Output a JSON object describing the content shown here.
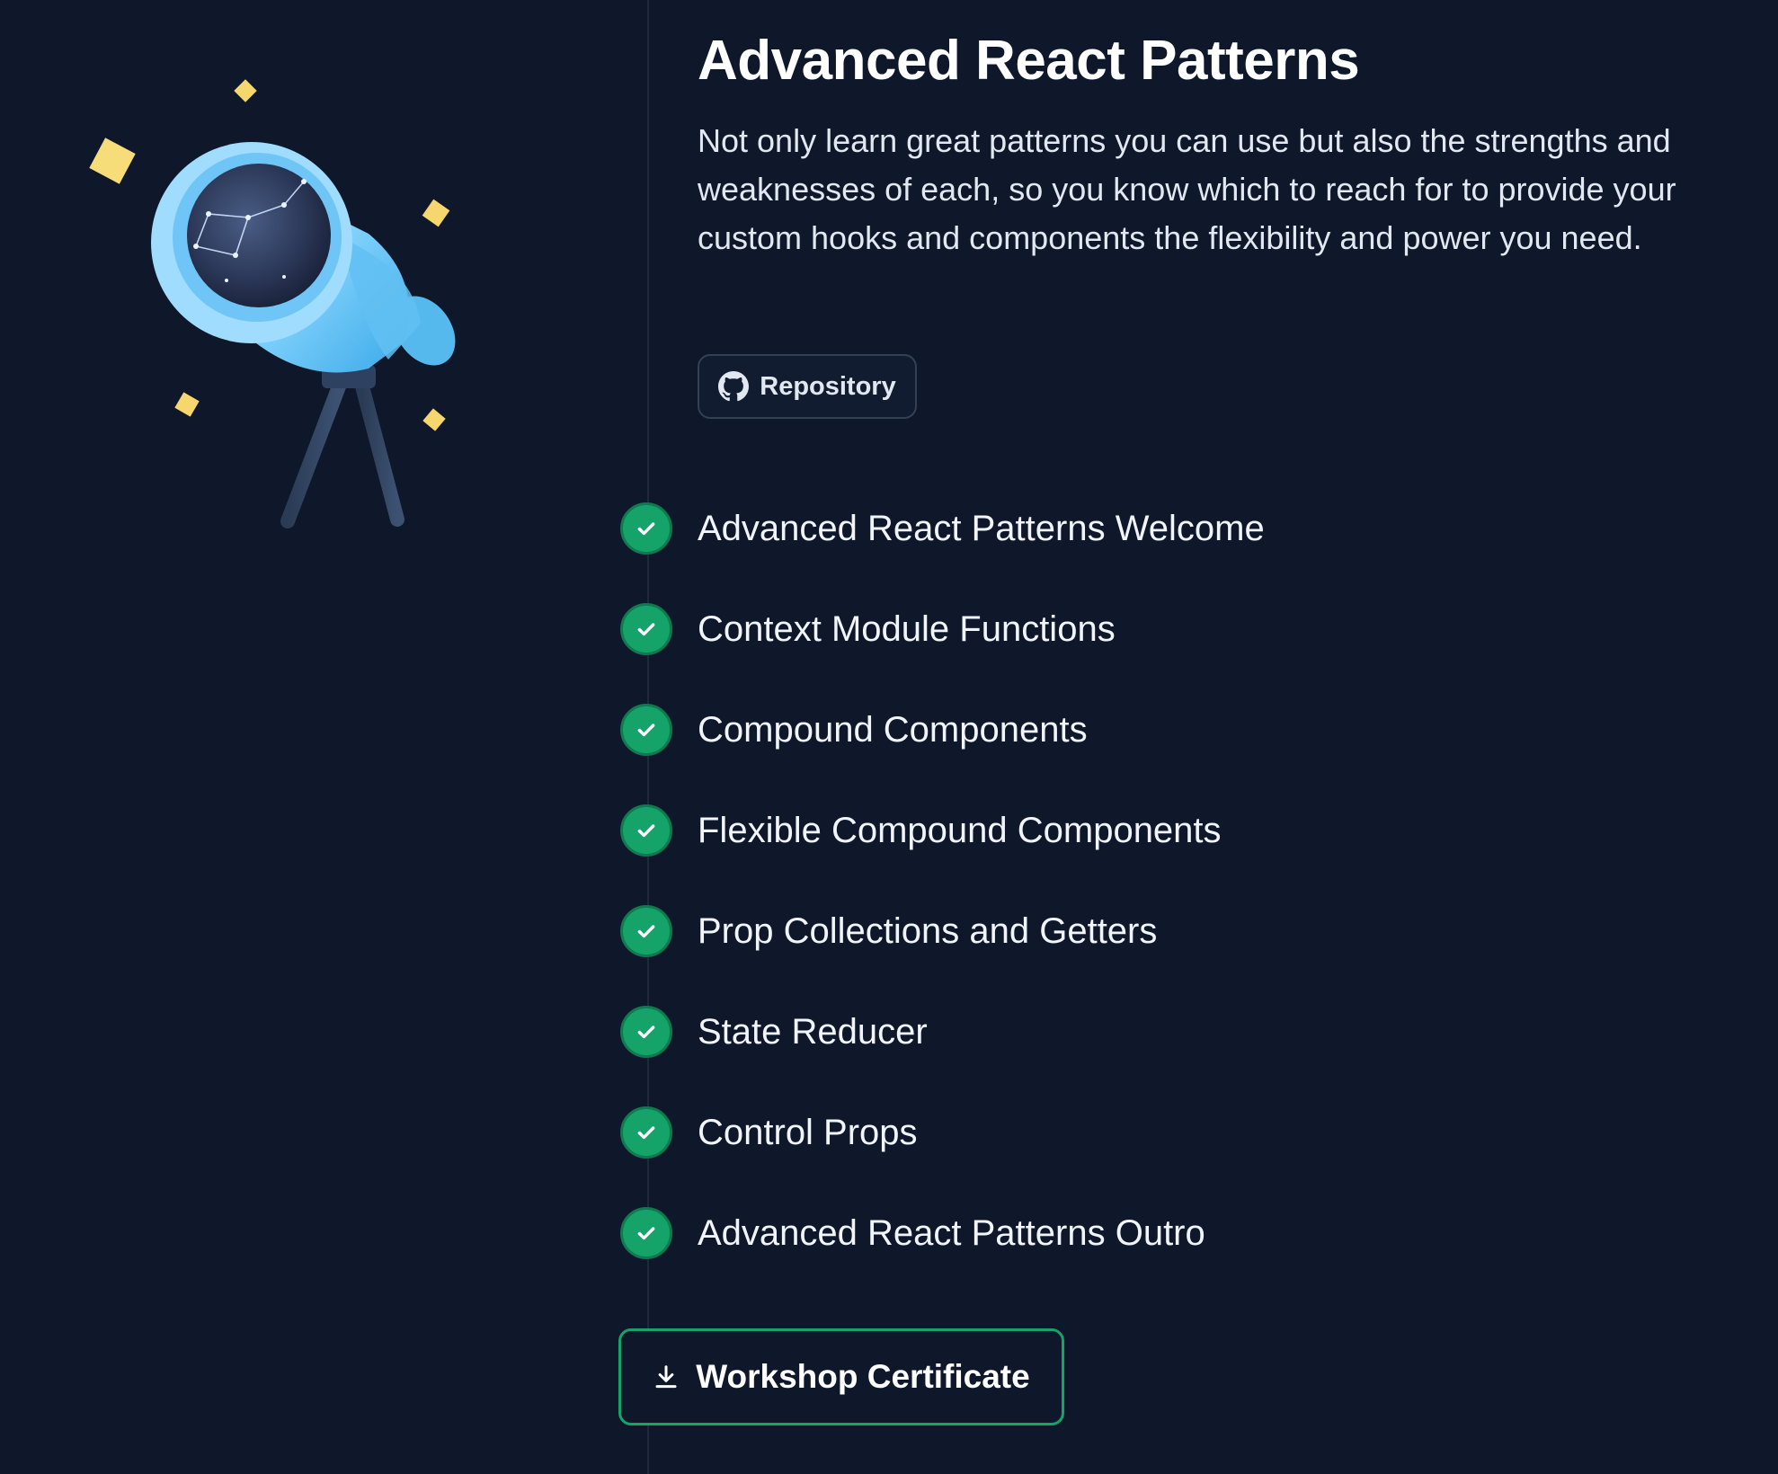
{
  "workshop": {
    "title": "Advanced React Patterns",
    "description": "Not only learn great patterns you can use but also the strengths and weaknesses of each, so you know which to reach for to provide your custom hooks and components the flexibility and power you need."
  },
  "repository_button": {
    "label": "Repository",
    "icon": "github-icon"
  },
  "illustration": {
    "icon": "telescope-illustration"
  },
  "steps": [
    {
      "label": "Advanced React Patterns Welcome",
      "completed": true
    },
    {
      "label": "Context Module Functions",
      "completed": true
    },
    {
      "label": "Compound Components",
      "completed": true
    },
    {
      "label": "Flexible Compound Components",
      "completed": true
    },
    {
      "label": "Prop Collections and Getters",
      "completed": true
    },
    {
      "label": "State Reducer",
      "completed": true
    },
    {
      "label": "Control Props",
      "completed": true
    },
    {
      "label": "Advanced React Patterns Outro",
      "completed": true
    }
  ],
  "certificate_button": {
    "label": "Workshop Certificate",
    "icon": "download-icon"
  },
  "colors": {
    "background": "#0f172a",
    "accent": "#16a36a",
    "text": "#f8fafc",
    "muted_text": "#e2e8f0",
    "sparkle": "#f5d76e",
    "telescope": "#7dd3fc"
  }
}
